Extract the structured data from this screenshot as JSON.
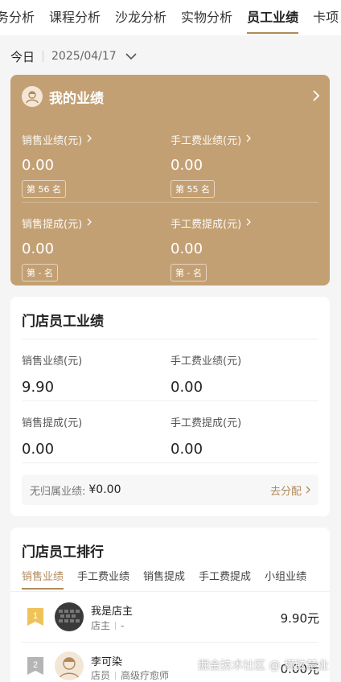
{
  "top_tabs": [
    "务分析",
    "课程分析",
    "沙龙分析",
    "实物分析",
    "员工业绩",
    "卡项"
  ],
  "date_bar": {
    "today": "今日",
    "date": "2025/04/17"
  },
  "my_performance": {
    "title": "我的业绩",
    "cells": [
      {
        "label": "销售业绩(元)",
        "value": "0.00",
        "rank": "第 56 名"
      },
      {
        "label": "手工费业绩(元)",
        "value": "0.00",
        "rank": "第 55 名"
      },
      {
        "label": "销售提成(元)",
        "value": "0.00",
        "rank": "第 - 名"
      },
      {
        "label": "手工费提成(元)",
        "value": "0.00",
        "rank": "第 - 名"
      }
    ]
  },
  "store_performance": {
    "title": "门店员工业绩",
    "cells": [
      {
        "label": "销售业绩(元)",
        "value": "9.90"
      },
      {
        "label": "手工费业绩(元)",
        "value": "0.00"
      },
      {
        "label": "销售提成(元)",
        "value": "0.00"
      },
      {
        "label": "手工费提成(元)",
        "value": "0.00"
      }
    ],
    "unassigned_label": "无归属业绩:",
    "unassigned_value": "¥0.00",
    "assign_link": "去分配"
  },
  "ranking": {
    "title": "门店员工排行",
    "tabs": [
      "销售业绩",
      "手工费业绩",
      "销售提成",
      "手工费提成",
      "小组业绩"
    ],
    "rows": [
      {
        "rank": "1",
        "name": "我是店主",
        "role": "店主",
        "sub": "-",
        "amount": "9.90元"
      },
      {
        "rank": "2",
        "name": "李可染",
        "role": "店员",
        "sub": "高级疗愈师",
        "amount": "0.00元"
      }
    ]
  },
  "watermark": "掘金技术社区 @ 横弦楚业",
  "colors": {
    "accent": "#b08a5c",
    "gold_card": "#c3a073",
    "rank1": "#f0c25a",
    "rank2": "#b5b5b5"
  }
}
